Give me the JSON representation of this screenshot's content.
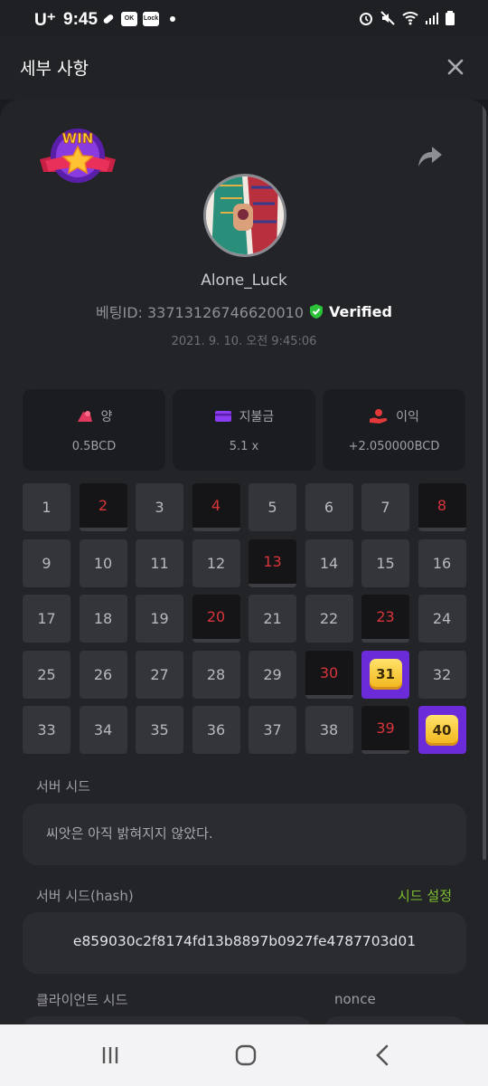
{
  "status_bar": {
    "carrier": "U⁺",
    "time": "9:45",
    "noti_ok": "OK",
    "noti_lock": "Lock"
  },
  "header": {
    "title": "세부 사항"
  },
  "bet": {
    "username": "Alone_Luck",
    "bet_id": "베팅ID: 3371312674662001​0",
    "verified": "Verified",
    "datetime": "2021. 9. 10. 오전 9:45:06",
    "badge_text": "WIN"
  },
  "stats": [
    {
      "label": "양",
      "value": "0.5BCD",
      "icon": "coins-icon",
      "color": "#e2395f"
    },
    {
      "label": "지불금",
      "value": "5.1 x",
      "icon": "card-icon",
      "color": "#8b3cf0"
    },
    {
      "label": "이익",
      "value": "+2.050000BCD",
      "icon": "hand-coin-icon",
      "color": "#e23a3a"
    }
  ],
  "grid": {
    "drawn": [
      2,
      4,
      8,
      13,
      20,
      23,
      30,
      39
    ],
    "hits": [
      31,
      40
    ],
    "numbers": [
      "1",
      "2",
      "3",
      "4",
      "5",
      "6",
      "7",
      "8",
      "9",
      "10",
      "11",
      "12",
      "13",
      "14",
      "15",
      "16",
      "17",
      "18",
      "19",
      "20",
      "21",
      "22",
      "23",
      "24",
      "25",
      "26",
      "27",
      "28",
      "29",
      "30",
      "31",
      "32",
      "33",
      "34",
      "35",
      "36",
      "37",
      "38",
      "39",
      "40"
    ]
  },
  "server_seed": {
    "label": "서버 시드",
    "value": "씨앗은 아직 밝혀지지 않았다."
  },
  "server_hash": {
    "label": "서버 시드(hash)",
    "link": "시드 설정",
    "value": "e859030c2f8174fd13b8897b0927fe4787703d01"
  },
  "client_seed": {
    "label": "클라이언트 시드"
  },
  "nonce": {
    "label": "nonce"
  },
  "colors": {
    "accent_purple": "#6b2bd9",
    "drawn_red": "#d8353a",
    "link_green": "#7fbf2e"
  }
}
